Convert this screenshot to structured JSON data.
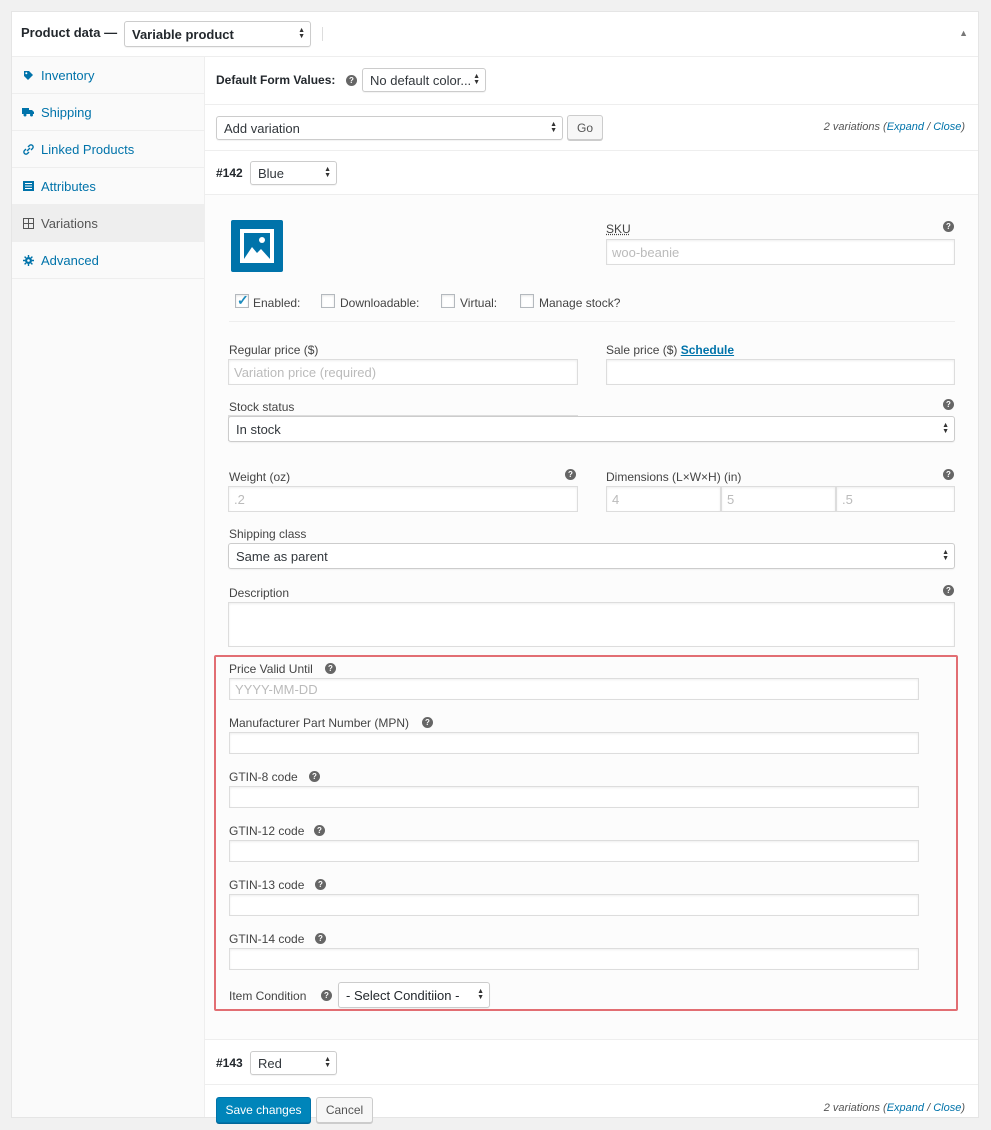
{
  "header": {
    "title": "Product data —",
    "product_type": "Variable product"
  },
  "sidebar": {
    "items": [
      {
        "label": "Inventory",
        "icon": "tag-icon"
      },
      {
        "label": "Shipping",
        "icon": "truck-icon"
      },
      {
        "label": "Linked Products",
        "icon": "link-icon"
      },
      {
        "label": "Attributes",
        "icon": "list-icon"
      },
      {
        "label": "Variations",
        "icon": "grid-icon",
        "active": true
      },
      {
        "label": "Advanced",
        "icon": "gear-icon"
      }
    ]
  },
  "defaults": {
    "label": "Default Form Values:",
    "value": "No default color..."
  },
  "add_row": {
    "select": "Add variation",
    "go": "Go",
    "count_prefix": "2 variations (",
    "expand": "Expand",
    "slash": " / ",
    "close": "Close",
    "count_suffix": ")"
  },
  "variation_1": {
    "number": "#142",
    "color": "Blue",
    "sku_label": "SKU",
    "sku_placeholder": "woo-beanie",
    "enabled_label": "Enabled:",
    "downloadable_label": "Downloadable:",
    "virtual_label": "Virtual:",
    "manage_stock_label": "Manage stock?",
    "regular_price_label": "Regular price ($)",
    "regular_price_placeholder": "Variation price (required)",
    "sale_price_label": "Sale price ($)",
    "schedule_link": "Schedule",
    "stock_status_label": "Stock status",
    "stock_status_value": "In stock",
    "weight_label": "Weight (oz)",
    "weight_placeholder": ".2",
    "dimensions_label": "Dimensions (L×W×H) (in)",
    "dim_l": "4",
    "dim_w": "5",
    "dim_h": ".5",
    "shipping_class_label": "Shipping class",
    "shipping_class_value": "Same as parent",
    "description_label": "Description",
    "price_valid_label": "Price Valid Until",
    "price_valid_placeholder": "YYYY-MM-DD",
    "mpn_label": "Manufacturer Part Number (MPN)",
    "gtin8_label": "GTIN-8 code",
    "gtin12_label": "GTIN-12 code",
    "gtin13_label": "GTIN-13 code",
    "gtin14_label": "GTIN-14 code",
    "condition_label": "Item Condition",
    "condition_value": "- Select Conditiion -"
  },
  "variation_2": {
    "number": "#143",
    "color": "Red"
  },
  "footer": {
    "save": "Save changes",
    "cancel": "Cancel"
  },
  "colors": {
    "link": "#0073aa",
    "primary": "#0085ba",
    "highlight_border": "#e26e73"
  }
}
